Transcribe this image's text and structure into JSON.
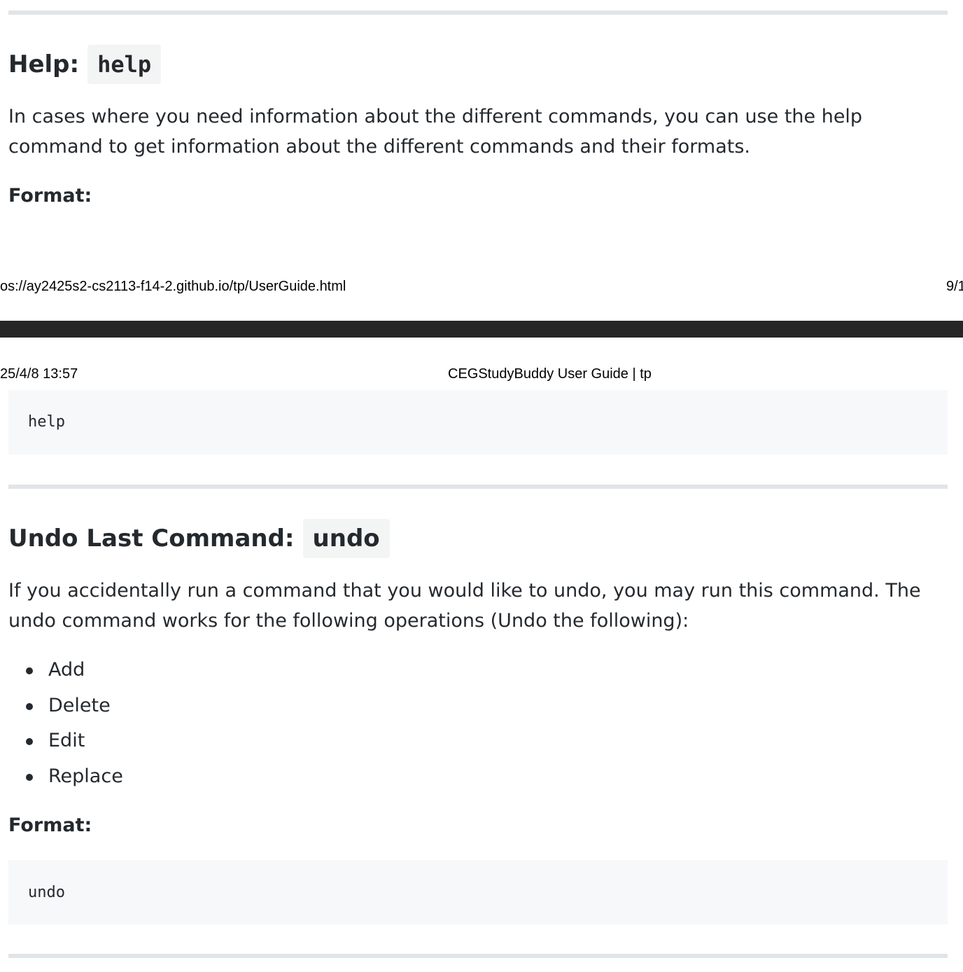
{
  "help_section": {
    "heading_text": "Help:",
    "heading_code": "help",
    "description": "In cases where you need information about the different commands, you can use the help command to get information about the different commands and their formats.",
    "format_label": "Format:",
    "format_code": "help"
  },
  "print_footer": {
    "url": "os://ay2425s2-cs2113-f14-2.github.io/tp/UserGuide.html",
    "page_number": "9/1"
  },
  "print_header": {
    "datetime": "25/4/8 13:57",
    "title": "CEGStudyBuddy User Guide | tp"
  },
  "undo_section": {
    "heading_text": "Undo Last Command:",
    "heading_code": "undo",
    "description": "If you accidentally run a command that you would like to undo, you may run this command. The undo command works for the following operations (Undo the following):",
    "operations": [
      "Add",
      "Delete",
      "Edit",
      "Replace"
    ],
    "format_label": "Format:",
    "format_code": "undo"
  }
}
